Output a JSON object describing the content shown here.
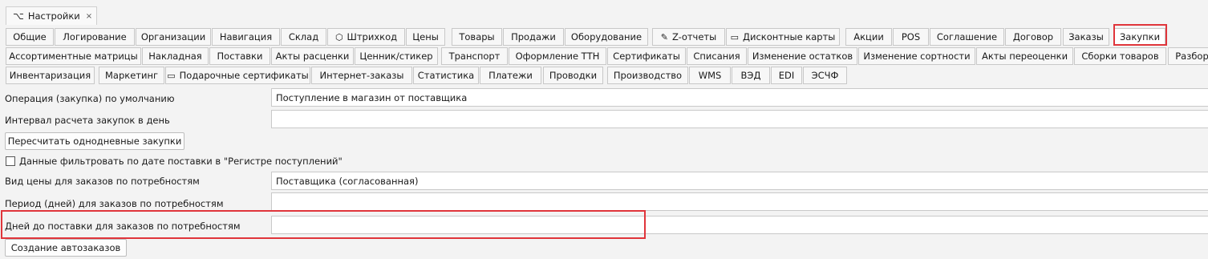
{
  "window": {
    "tab_title": "Настройки",
    "tab_icon": "⌥",
    "close_glyph": "×"
  },
  "tabs_row1": [
    {
      "label": "Общие"
    },
    {
      "label": "Логирование"
    },
    {
      "label": "Организации"
    },
    {
      "label": "Навигация"
    },
    {
      "label": "Склад"
    },
    {
      "label": "Штрихкод",
      "icon": "box-icon"
    },
    {
      "label": "Цены"
    },
    {
      "label": "Товары"
    },
    {
      "label": "Продажи"
    },
    {
      "label": "Оборудование"
    },
    {
      "label": "Z-отчеты",
      "icon": "edit-icon"
    },
    {
      "label": "Дисконтные карты",
      "icon": "card-icon"
    },
    {
      "label": "Акции"
    },
    {
      "label": "POS"
    },
    {
      "label": "Соглашение"
    },
    {
      "label": "Договор"
    },
    {
      "label": "Заказы"
    },
    {
      "label": "Закупки",
      "active": true
    }
  ],
  "tabs_row2": [
    {
      "label": "Ассортиментные матрицы"
    },
    {
      "label": "Накладная"
    },
    {
      "label": "Поставки"
    },
    {
      "label": "Акты расценки"
    },
    {
      "label": "Ценник/стикер"
    },
    {
      "label": "Транспорт"
    },
    {
      "label": "Оформление ТТН"
    },
    {
      "label": "Сертификаты"
    },
    {
      "label": "Списания"
    },
    {
      "label": "Изменение остатков"
    },
    {
      "label": "Изменение сортности"
    },
    {
      "label": "Акты переоценки"
    },
    {
      "label": "Сборки товаров"
    },
    {
      "label": "Разбор"
    }
  ],
  "tabs_row3": [
    {
      "label": "Инвентаризация"
    },
    {
      "label": "Маркетинг"
    },
    {
      "label": "Подарочные сертификаты",
      "icon": "card-icon"
    },
    {
      "label": "Интернет-заказы"
    },
    {
      "label": "Статистика"
    },
    {
      "label": "Платежи"
    },
    {
      "label": "Проводки"
    },
    {
      "label": "Производство"
    },
    {
      "label": "WMS"
    },
    {
      "label": "ВЭД"
    },
    {
      "label": "EDI"
    },
    {
      "label": "ЭСЧФ"
    }
  ],
  "form": {
    "default_operation_label": "Операция (закупка) по умолчанию",
    "default_operation_value": "Поступление в магазин от поставщика",
    "interval_label": "Интервал расчета закупок в день",
    "interval_value": "",
    "recalc_button": "Пересчитать однодневные закупки",
    "filter_checkbox_label": "Данные фильтровать по дате поставки в \"Регистре поступлений\"",
    "filter_checked": false,
    "price_type_label": "Вид цены для заказов по потребностям",
    "price_type_value": "Поставщика (согласованная)",
    "period_label": "Период (дней) для заказов по потребностям",
    "period_value": "",
    "delivery_days_label": "Дней до поставки для заказов по потребностям",
    "delivery_days_value": "",
    "auto_orders_button": "Создание автозаказов"
  },
  "colors": {
    "highlight": "#e0353b"
  }
}
